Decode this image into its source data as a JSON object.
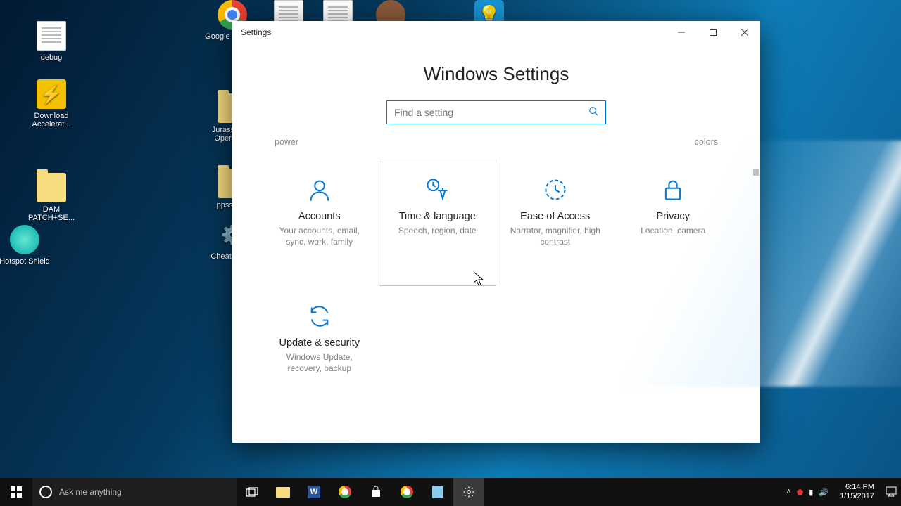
{
  "desktop_icons": [
    {
      "name": "debug",
      "kind": "txt"
    },
    {
      "name": "Download Accelerat...",
      "kind": "app"
    },
    {
      "name": "DAM PATCH+SE...",
      "kind": "folder"
    },
    {
      "name": "Hotspot Shield",
      "kind": "app"
    },
    {
      "name": "Google Chrome",
      "kind": "chrome"
    },
    {
      "name": "Jurassic P... Operatio...",
      "kind": "folder"
    },
    {
      "name": "ppsspp...",
      "kind": "folder"
    },
    {
      "name": "Cheat Eng...",
      "kind": "app"
    }
  ],
  "window": {
    "title": "Settings",
    "heading": "Windows Settings",
    "search_placeholder": "Find a setting",
    "hint_left": "power",
    "hint_right": "colors"
  },
  "tiles": [
    {
      "id": "accounts",
      "name": "Accounts",
      "desc": "Your accounts, email, sync, work, family",
      "selected": false
    },
    {
      "id": "time-language",
      "name": "Time & language",
      "desc": "Speech, region, date",
      "selected": true
    },
    {
      "id": "ease-of-access",
      "name": "Ease of Access",
      "desc": "Narrator, magnifier, high contrast",
      "selected": false
    },
    {
      "id": "privacy",
      "name": "Privacy",
      "desc": "Location, camera",
      "selected": false
    },
    {
      "id": "update-security",
      "name": "Update & security",
      "desc": "Windows Update, recovery, backup",
      "selected": false
    }
  ],
  "taskbar": {
    "search_placeholder": "Ask me anything",
    "time": "6:14 PM",
    "date": "1/15/2017"
  }
}
